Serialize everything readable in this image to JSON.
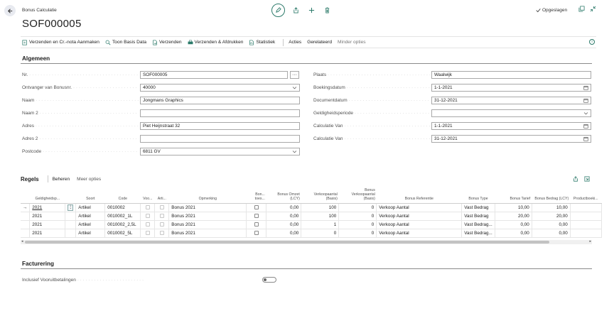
{
  "header": {
    "page_kind": "Bonus Calculatie",
    "title": "SOF000005",
    "saved_label": "Opgeslagen"
  },
  "actions": {
    "items": [
      {
        "label": "Verzenden en Cr.-nota Aanmaken",
        "icon": "post-credit-icon"
      },
      {
        "label": "Toon Basis Data",
        "icon": "search-data-icon"
      },
      {
        "label": "Verzenden",
        "icon": "send-icon"
      },
      {
        "label": "Verzenden & Afdrukken",
        "icon": "print-icon"
      },
      {
        "label": "Statistiek",
        "icon": "statistics-icon"
      }
    ],
    "acties": "Acties",
    "gerelateerd": "Gerelateerd",
    "minder_opties": "Minder opties"
  },
  "algemeen": {
    "title": "Algemeen",
    "left": [
      {
        "label": "Nr.",
        "value": "SOF000005",
        "control": "lookup"
      },
      {
        "label": "Ontvanger van Bonusnr.",
        "value": "40000",
        "control": "dropdown"
      },
      {
        "label": "Naam",
        "value": "Jongmans Graphics",
        "control": "text"
      },
      {
        "label": "Naam 2",
        "value": "",
        "control": "text"
      },
      {
        "label": "Adres",
        "value": "Piet Heijnstraat 32",
        "control": "text"
      },
      {
        "label": "Adres 2",
        "value": "",
        "control": "text"
      },
      {
        "label": "Postcode",
        "value": "6811 GV",
        "control": "dropdown"
      }
    ],
    "right": [
      {
        "label": "Plaats",
        "value": "Waalwijk",
        "control": "text"
      },
      {
        "label": "Boekingsdatum",
        "value": "1-1-2021",
        "control": "date"
      },
      {
        "label": "Documentdatum",
        "value": "31-12-2021",
        "control": "date"
      },
      {
        "label": "Geldigheidsperiode",
        "value": "",
        "control": "dropdown"
      },
      {
        "label": "Calculatie Van",
        "value": "1-1-2021",
        "control": "date"
      },
      {
        "label": "Calculatie Van",
        "value": "31-12-2021",
        "control": "date"
      }
    ]
  },
  "regels": {
    "title": "Regels",
    "beheren": "Beheren",
    "meer_opties": "Meer opties",
    "columns": [
      "Geldigheidsp...",
      "Soort",
      "Code",
      "Voo...",
      "Arti...",
      "Opmerking",
      "Bon... toes...",
      "Bonus Omzet (LCY)",
      "Verkoopaantal (Basis)",
      "Bonus Verkoopaantal (Basis)",
      "Bonus Referentie",
      "Bonus Type",
      "Bonus Tarief",
      "Bonus Bedrag (LCY)",
      "Productboeki..."
    ],
    "rows": [
      {
        "period": "2021",
        "soort": "Artikel",
        "code": "0010002",
        "opmerking": "Bonus 2021",
        "omzet": "0,00",
        "verkoop": "100",
        "bonus_verkoop": "0",
        "referentie": "Verkoop Aantal",
        "type": "Vast Bedrag",
        "tarief": "10,00",
        "bedrag": "10,00",
        "selected": true
      },
      {
        "period": "2021",
        "soort": "Artikel",
        "code": "0010002_1L",
        "opmerking": "Bonus 2021",
        "omzet": "0,00",
        "verkoop": "100",
        "bonus_verkoop": "0",
        "referentie": "Verkoop Aantal",
        "type": "Vast Bedrag",
        "tarief": "20,00",
        "bedrag": "20,00",
        "selected": false
      },
      {
        "period": "2021",
        "soort": "Artikel",
        "code": "0010002_2,5L",
        "opmerking": "Bonus 2021",
        "omzet": "0,00",
        "verkoop": "1",
        "bonus_verkoop": "0",
        "referentie": "Verkoop Aantal",
        "type": "Vast Bedrag...",
        "tarief": "0,00",
        "bedrag": "0,00",
        "selected": false
      },
      {
        "period": "2021",
        "soort": "Artikel",
        "code": "0010002_5L",
        "opmerking": "Bonus 2021",
        "omzet": "0,00",
        "verkoop": "0",
        "bonus_verkoop": "0",
        "referentie": "Verkoop Aantal",
        "type": "Vast Bedrag...",
        "tarief": "0,00",
        "bedrag": "0,00",
        "selected": false
      }
    ]
  },
  "facturering": {
    "title": "Facturering",
    "field_label": "Inclusief Vooruitbetalingen",
    "toggle_on": false
  },
  "colors": {
    "accent": "#2c7a6a",
    "border": "#a8a8a8",
    "text": "#212121"
  }
}
